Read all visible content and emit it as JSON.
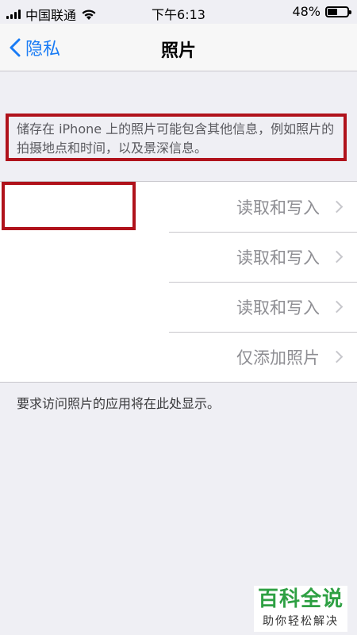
{
  "status_bar": {
    "carrier": "中国联通",
    "time": "下午6:13",
    "battery": "48%",
    "battery_level": 0.48
  },
  "nav": {
    "back_label": "隐私",
    "title": "照片"
  },
  "info": {
    "text": "储存在 iPhone 上的照片可能包含其他信息，例如照片的拍摄地点和时间，以及景深信息。"
  },
  "apps": [
    {
      "name": "",
      "value": "读取和写入"
    },
    {
      "name": "",
      "value": "读取和写入"
    },
    {
      "name": "",
      "value": "读取和写入"
    },
    {
      "name": "",
      "value": "仅添加照片"
    }
  ],
  "footer": {
    "note": "要求访问照片的应用将在此处显示。"
  },
  "watermark": {
    "main": "百科全说",
    "sub": "助你轻松解决"
  },
  "colors": {
    "accent": "#1a7cf5",
    "highlight": "#b0121b",
    "watermark_green": "#2ea043"
  }
}
